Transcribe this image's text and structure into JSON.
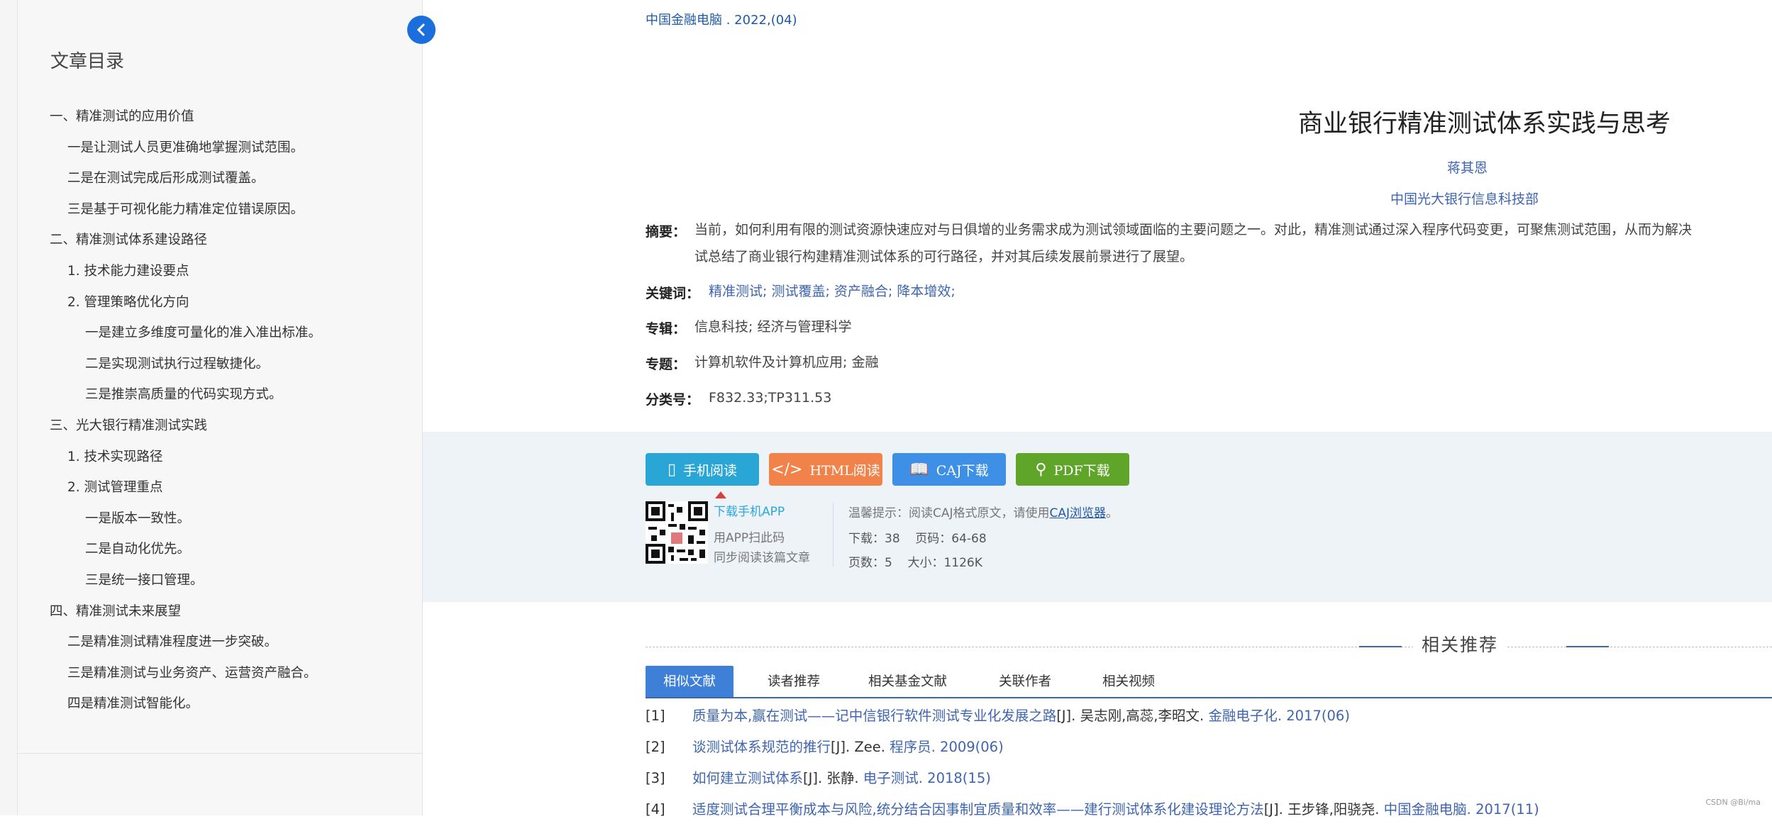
{
  "toc": {
    "title": "文章目录",
    "items": [
      {
        "label": "一、精准测试的应用价值",
        "level": 1
      },
      {
        "label": "一是让测试人员更准确地掌握测试范围。",
        "level": 2
      },
      {
        "label": "二是在测试完成后形成测试覆盖。",
        "level": 2
      },
      {
        "label": "三是基于可视化能力精准定位错误原因。",
        "level": 2
      },
      {
        "label": "二、精准测试体系建设路径",
        "level": 1
      },
      {
        "label": "1. 技术能力建设要点",
        "level": 2
      },
      {
        "label": "2. 管理策略优化方向",
        "level": 2
      },
      {
        "label": "一是建立多维度可量化的准入准出标准。",
        "level": 3
      },
      {
        "label": "二是实现测试执行过程敏捷化。",
        "level": 3
      },
      {
        "label": "三是推崇高质量的代码实现方式。",
        "level": 3
      },
      {
        "label": "三、光大银行精准测试实践",
        "level": 1
      },
      {
        "label": "1. 技术实现路径",
        "level": 2
      },
      {
        "label": "2. 测试管理重点",
        "level": 2
      },
      {
        "label": "一是版本一致性。",
        "level": 3
      },
      {
        "label": "二是自动化优先。",
        "level": 3
      },
      {
        "label": "三是统一接口管理。",
        "level": 3
      },
      {
        "label": "四、精准测试未来展望",
        "level": 1
      },
      {
        "label": "二是精准测试精准程度进一步突破。",
        "level": 2
      },
      {
        "label": "三是精准测试与业务资产、运营资产融合。",
        "level": 2
      },
      {
        "label": "四是精准测试智能化。",
        "level": 2
      }
    ]
  },
  "article": {
    "source": "中国金融电脑 . 2022,(04)",
    "title": "商业银行精准测试体系实践与思考",
    "author": "蒋其恩",
    "org": "中国光大银行信息科技部",
    "abstract_label": "摘要：",
    "abstract_line1": "当前，如何利用有限的测试资源快速应对与日俱增的业务需求成为测试领域面临的主要问题之一。对此，精准测试通过深入程序代码变更，可聚焦测试范围，从而为解决",
    "abstract_line2": "试总结了商业银行构建精准测试体系的可行路径，并对其后续发展前景进行了展望。",
    "keywords_label": "关键词：",
    "keywords": "精准测试;  测试覆盖;  资产融合;  降本增效;",
    "album_label": "专辑：",
    "album": "信息科技; 经济与管理科学",
    "topic_label": "专题：",
    "topic": "计算机软件及计算机应用; 金融",
    "class_label": "分类号：",
    "class_no": "F832.33;TP311.53"
  },
  "tools": {
    "buttons": [
      {
        "label": "手机阅读",
        "icon": "phone-icon",
        "color": "#2aa6d6"
      },
      {
        "label": "HTML阅读",
        "icon": "code-icon",
        "color": "#f0824a"
      },
      {
        "label": "CAJ下载",
        "icon": "book-icon",
        "color": "#3d90e6"
      },
      {
        "label": "PDF下载",
        "icon": "pdf-icon",
        "color": "#5fa52a"
      }
    ],
    "app_link": "下载手机APP",
    "app_tip1": "用APP扫此码",
    "app_tip2": "同步阅读该篇文章",
    "hint_prefix": "温馨提示：阅读CAJ格式原文，请使用",
    "hint_link": "CAJ浏览器",
    "hint_suffix": "。",
    "downloads": "下载：38",
    "pages": "页码：64-68",
    "page_count": "页数：5",
    "size": "大小：1126K"
  },
  "recommend": {
    "title": "相关推荐",
    "tabs": [
      "相似文献",
      "读者推荐",
      "相关基金文献",
      "关联作者",
      "相关视频"
    ],
    "refs": [
      {
        "no": "[1]",
        "title": "质量为本,赢在测试——记中信银行软件测试专业化发展之路",
        "authors": "[J]. 吴志刚,高蕊,李昭文.",
        "journal": "金融电子化. 2017(06)"
      },
      {
        "no": "[2]",
        "title": "谈测试体系规范的推行",
        "authors": "[J]. Zee.",
        "journal": "程序员. 2009(06)"
      },
      {
        "no": "[3]",
        "title": "如何建立测试体系",
        "authors": "[J]. 张静.",
        "journal": "电子测试. 2018(15)"
      },
      {
        "no": "[4]",
        "title": "适度测试合理平衡成本与风险,统分结合因事制宜质量和效率——建行测试体系化建设理论方法",
        "authors": "[J]. 王步锋,阳骁尧.",
        "journal": "中国金融电脑. 2017(11)"
      }
    ]
  },
  "watermark": "CSDN @Bi/ma"
}
